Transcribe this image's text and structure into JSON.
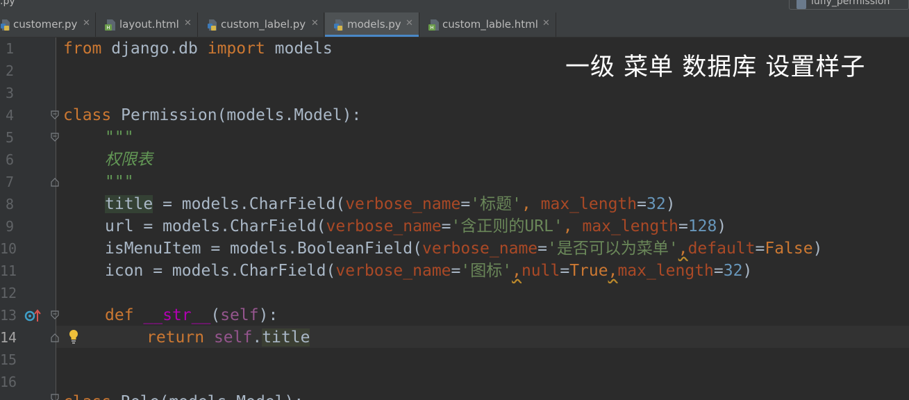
{
  "window": {
    "file_fragment": ".py",
    "run_config_label": "lufly_permission"
  },
  "tabs": [
    {
      "label": "customer.py",
      "type": "python",
      "active": false
    },
    {
      "label": "layout.html",
      "type": "html",
      "active": false
    },
    {
      "label": "custom_label.py",
      "type": "python",
      "active": false
    },
    {
      "label": "models.py",
      "type": "python",
      "active": true
    },
    {
      "label": "custom_lable.html",
      "type": "html",
      "active": false
    }
  ],
  "editor": {
    "current_line": 14,
    "line_numbers": [
      "1",
      "2",
      "3",
      "4",
      "5",
      "6",
      "7",
      "8",
      "9",
      "10",
      "11",
      "12",
      "13",
      "14",
      "15",
      "16"
    ],
    "code": {
      "l1_from": "from",
      "l1_mod": " django.db ",
      "l1_import": "import",
      "l1_name": " models",
      "l4_class": "class",
      "l4_rest": " Permission(models.Model):",
      "l5_doc": "\"\"\"",
      "l6_doc": "权限表",
      "l7_doc": "\"\"\"",
      "l8_var": "title",
      "l8_a": " = models.CharField(",
      "l8_kw1": "verbose_name",
      "l8_eq1": "=",
      "l8_str": "'标题'",
      "l8_sep": ", ",
      "l8_kw2": "max_length",
      "l8_eq2": "=",
      "l8_num": "32",
      "l8_end": ")",
      "l9_a": "url = models.CharField(",
      "l9_kw1": "verbose_name",
      "l9_eq1": "=",
      "l9_str": "'含正则的URL'",
      "l9_sep": ", ",
      "l9_kw2": "max_length",
      "l9_eq2": "=",
      "l9_num": "128",
      "l9_end": ")",
      "l10_a": "isMenuItem = models.BooleanField(",
      "l10_kw1": "verbose_name",
      "l10_eq1": "=",
      "l10_str": "'是否可以为菜单'",
      "l10_sep": ",",
      "l10_kw2": "default",
      "l10_eq2": "=",
      "l10_val": "False",
      "l10_end": ")",
      "l11_a": "icon = models.CharField(",
      "l11_kw1": "verbose_name",
      "l11_eq1": "=",
      "l11_str": "'图标'",
      "l11_sep1": ",",
      "l11_kw2": "null",
      "l11_eq2": "=",
      "l11_val": "True",
      "l11_sep2": ",",
      "l11_kw3": "max_length",
      "l11_eq3": "=",
      "l11_num": "32",
      "l11_end": ")",
      "l13_def": "def",
      "l13_sp": " ",
      "l13_magic": "__str__",
      "l13_open": "(",
      "l13_self": "self",
      "l13_close": "):",
      "l14_return": "return",
      "l14_sp": " ",
      "l14_self": "self",
      "l14_dot": ".",
      "l14_attr": "title",
      "l17_class": "class",
      "l17_rest": " Role(models.Model):"
    }
  },
  "overlay_caption": "一级 菜单 数据库 设置样子",
  "icons": {
    "python_file": "python-file-icon",
    "html_file": "html-file-icon",
    "close": "close-icon",
    "fold": "fold-marker-icon",
    "bulb": "intention-bulb-icon",
    "override": "override-method-icon"
  },
  "colors": {
    "background": "#2b2b2b",
    "keyword": "#cc7832",
    "string": "#6a8759",
    "number": "#6897bb",
    "param": "#aa4926",
    "magic": "#b200b2",
    "self": "#94558d",
    "docstring": "#629755",
    "tab_underline": "#4a88c7"
  }
}
